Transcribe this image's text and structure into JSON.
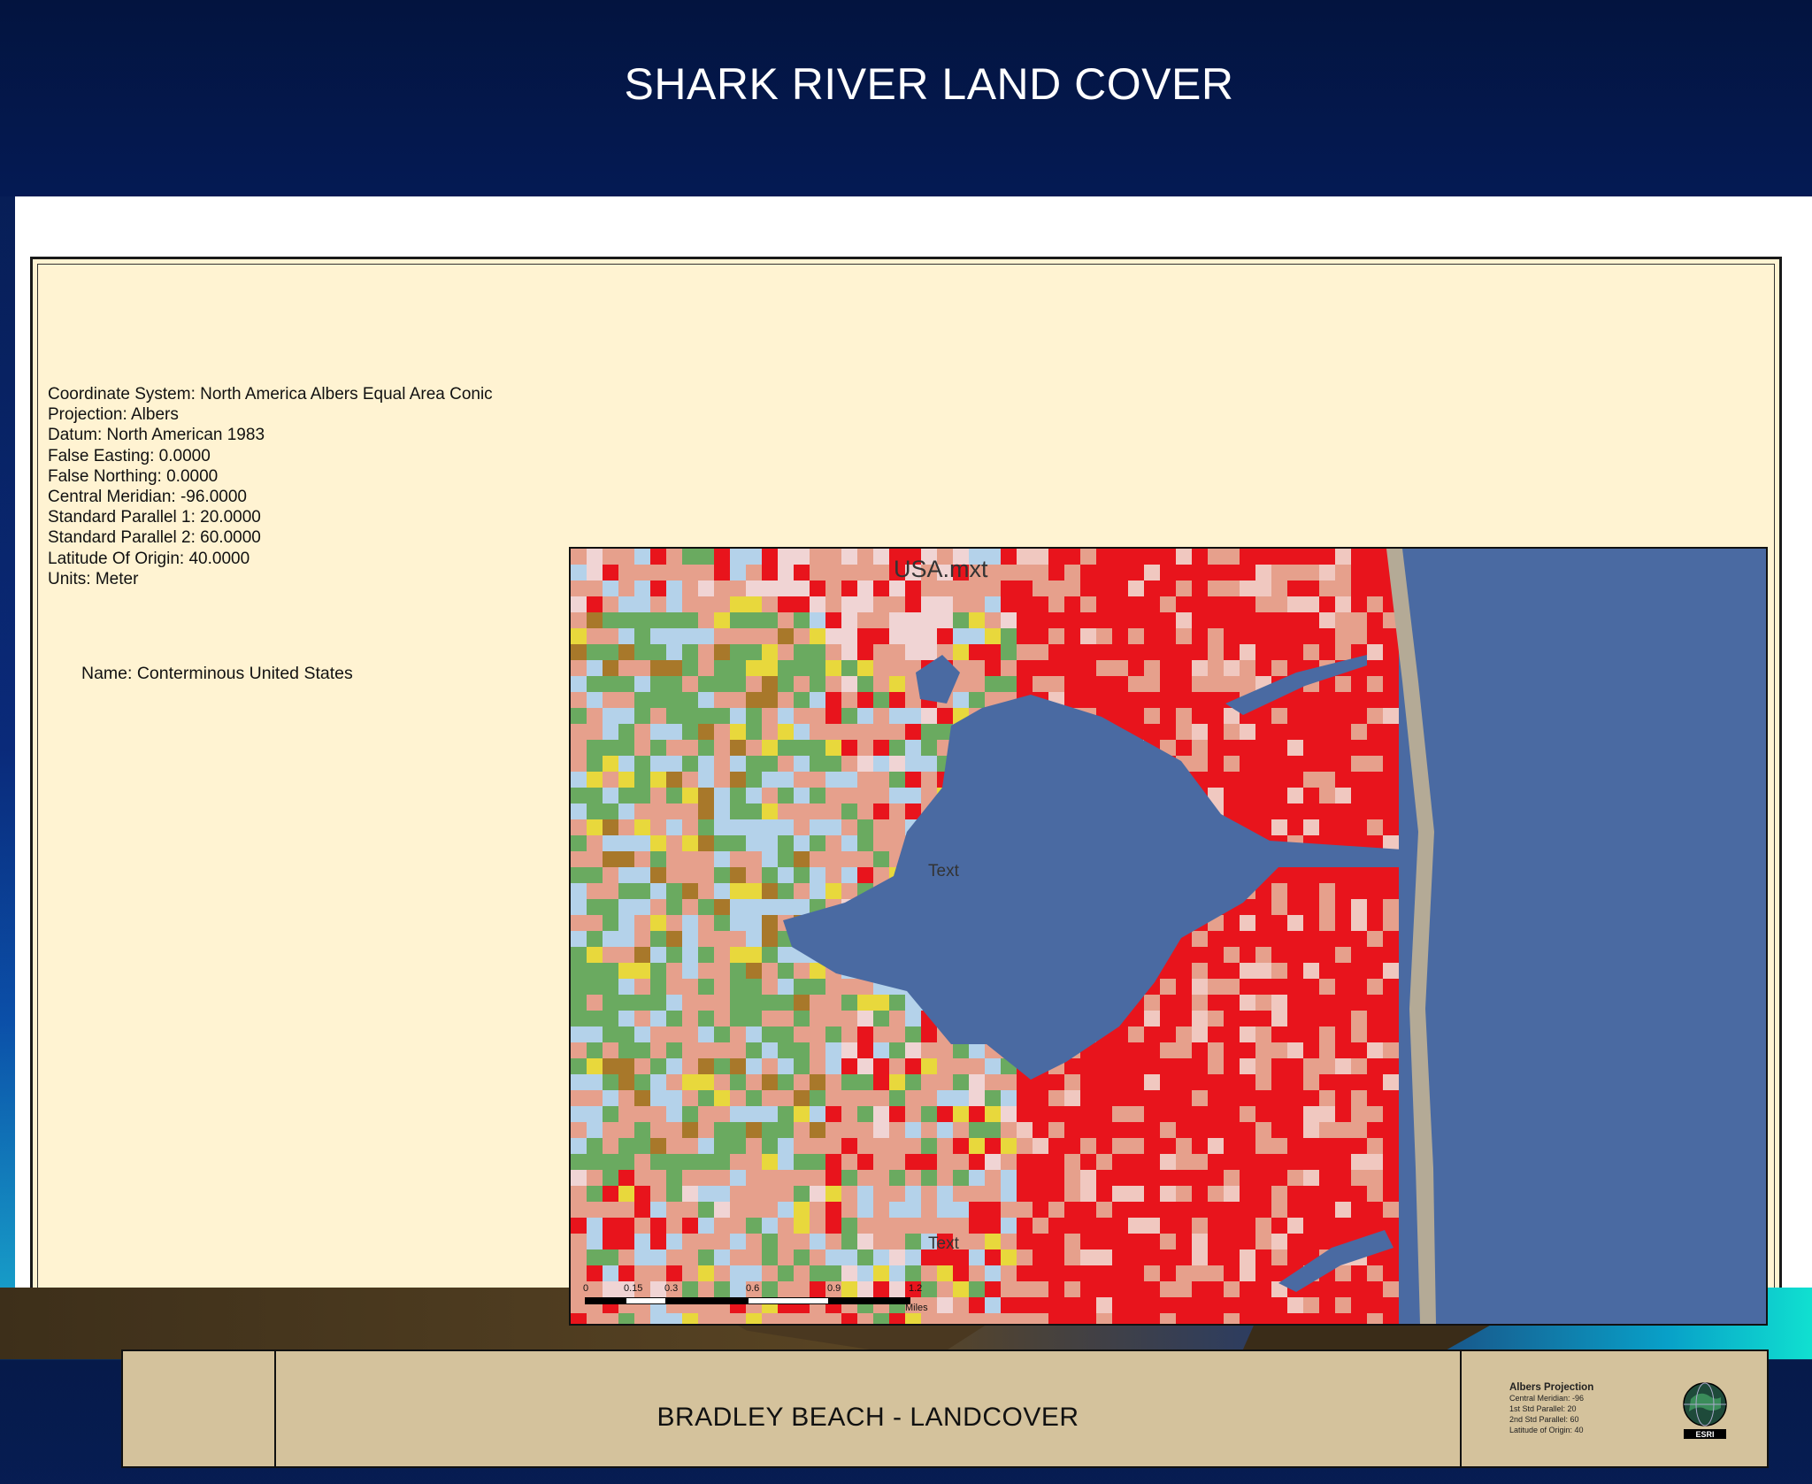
{
  "slide": {
    "title": "SHARK RIVER LAND COVER"
  },
  "coordinate_info": [
    "Coordinate System: North America Albers Equal Area Conic",
    "Projection: Albers",
    "Datum: North American 1983",
    "False Easting: 0.0000",
    "False Northing: 0.0000",
    "Central Meridian: -96.0000",
    "Standard Parallel 1: 20.0000",
    "Standard Parallel 2: 60.0000",
    "Latitude Of Origin: 40.0000",
    "Units: Meter"
  ],
  "name_text": "Name: Conterminous United States",
  "map": {
    "title": "USA.mxt",
    "labels": [
      "Text",
      "Text"
    ],
    "scale_ticks": [
      "0",
      "0.15",
      "0.3",
      "0.6",
      "0.9",
      "1.2"
    ],
    "scale_unit": "Miles"
  },
  "title_block": {
    "title": "BRADLEY BEACH - LANDCOVER",
    "projection_heading": "Albers Projection",
    "projection_lines": [
      "Central Meridian: -96",
      "1st Std Parallel: 20",
      "2nd Std Parallel: 60",
      "Latitude of Origin: 40"
    ],
    "logo_text": "ESRI"
  },
  "colors": {
    "water": "#4a6aa2",
    "high_intensity_developed": "#e8141c",
    "low_intensity_developed": "#e6a08c",
    "forest": "#6aaa60",
    "wetland": "#b4d2ea",
    "sand": "#b4aa96",
    "grassland": "#e8d83c"
  }
}
